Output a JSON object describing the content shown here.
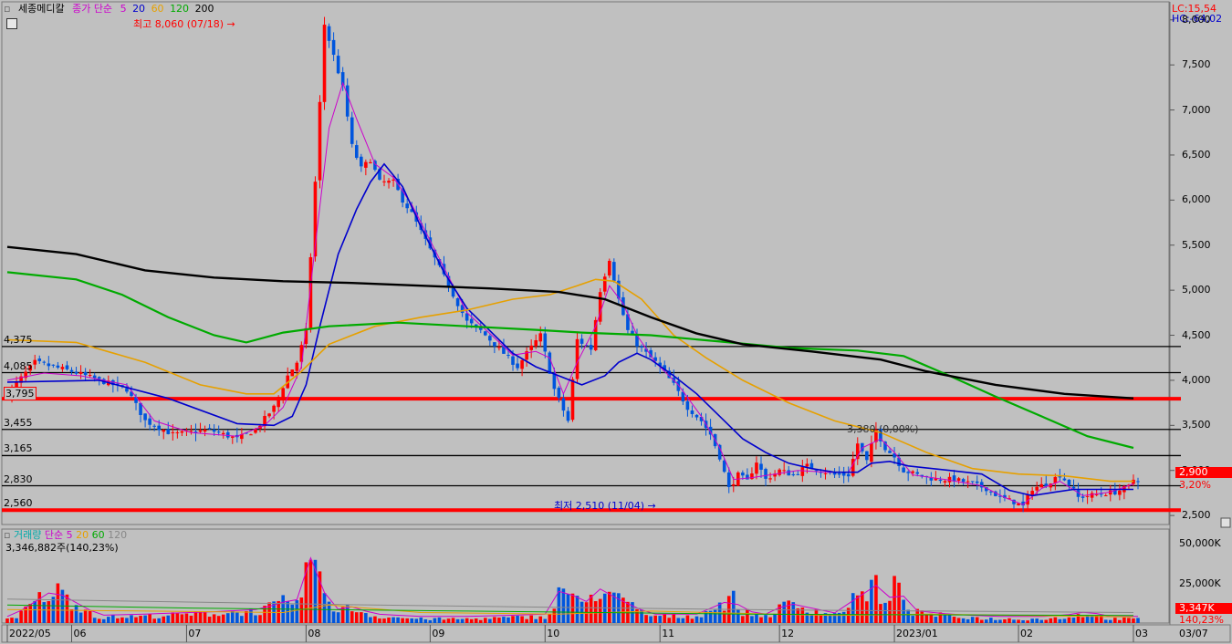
{
  "header": {
    "stock_name": "세종메디칼",
    "ma_title": "종가 단순",
    "ma_periods": [
      "5",
      "20",
      "60",
      "120",
      "200"
    ],
    "ma_colors": [
      "#cc00cc",
      "#0000cc",
      "#e6a000",
      "#00aa00",
      "#000000"
    ]
  },
  "top_right": {
    "lc": "LC:15,54",
    "hc": "HC:-64,02"
  },
  "annotations": {
    "high": "최고 8,060 (07/18)",
    "low": "최저 2,510 (11/04)",
    "mid": "3,380 (0,00%)"
  },
  "price_axis": [
    "8,000",
    "7,500",
    "7,000",
    "6,500",
    "6,000",
    "5,500",
    "5,000",
    "4,500",
    "4,000",
    "3,500",
    "3,000",
    "2,500"
  ],
  "current": {
    "price": "2,900",
    "change": "3,20%"
  },
  "levels": [
    {
      "label": "4,375",
      "value": 4375,
      "color": "#000000",
      "bold": false
    },
    {
      "label": "4,085",
      "value": 4085,
      "color": "#000000",
      "bold": false
    },
    {
      "label": "3,795",
      "value": 3795,
      "color": "#ff0000",
      "bold": true
    },
    {
      "label": "3,455",
      "value": 3455,
      "color": "#000000",
      "bold": false
    },
    {
      "label": "3,165",
      "value": 3165,
      "color": "#000000",
      "bold": false
    },
    {
      "label": "2,830",
      "value": 2830,
      "color": "#000000",
      "bold": false
    },
    {
      "label": "2,560",
      "value": 2560,
      "color": "#ff0000",
      "bold": true
    }
  ],
  "volume": {
    "title": "거래량",
    "ma_title": "단순",
    "ma_periods": [
      "5",
      "20",
      "60",
      "120"
    ],
    "info": "3,346,882주(140,23%)",
    "axis": [
      "50,000K",
      "25,000K"
    ],
    "current": "3,347K",
    "pct": "140,23%"
  },
  "date_axis": [
    "2022/05",
    "06",
    "07",
    "08",
    "09",
    "10",
    "11",
    "12",
    "2023/01",
    "02",
    "03",
    "03/07"
  ],
  "chart_data": {
    "type": "candlestick",
    "title": "세종메디칼",
    "ylim": [
      2400,
      8200
    ],
    "xlabels": [
      "2022/05",
      "06",
      "07",
      "08",
      "09",
      "10",
      "11",
      "12",
      "2023/01",
      "02",
      "03"
    ],
    "high": {
      "value": 8060,
      "date": "07/18"
    },
    "low": {
      "value": 2510,
      "date": "11/04"
    },
    "close_series": [
      [
        0,
        3850
      ],
      [
        6,
        4200
      ],
      [
        14,
        4100
      ],
      [
        26,
        3900
      ],
      [
        30,
        3550
      ],
      [
        36,
        3400
      ],
      [
        44,
        3450
      ],
      [
        50,
        3350
      ],
      [
        54,
        3450
      ],
      [
        58,
        3700
      ],
      [
        61,
        4050
      ],
      [
        63,
        4200
      ],
      [
        65,
        4550
      ],
      [
        67,
        6200
      ],
      [
        69,
        7950
      ],
      [
        71,
        7600
      ],
      [
        73,
        7250
      ],
      [
        75,
        6600
      ],
      [
        77,
        6350
      ],
      [
        79,
        6450
      ],
      [
        81,
        6200
      ],
      [
        84,
        6200
      ],
      [
        86,
        6000
      ],
      [
        88,
        5850
      ],
      [
        91,
        5550
      ],
      [
        95,
        5150
      ],
      [
        98,
        4850
      ],
      [
        100,
        4650
      ],
      [
        103,
        4550
      ],
      [
        106,
        4400
      ],
      [
        109,
        4250
      ],
      [
        111,
        4150
      ],
      [
        113,
        4300
      ],
      [
        116,
        4500
      ],
      [
        119,
        3900
      ],
      [
        122,
        3550
      ],
      [
        124,
        4450
      ],
      [
        127,
        4350
      ],
      [
        129,
        5000
      ],
      [
        131,
        5350
      ],
      [
        133,
        4900
      ],
      [
        135,
        4550
      ],
      [
        137,
        4400
      ],
      [
        139,
        4300
      ],
      [
        142,
        4150
      ],
      [
        145,
        3950
      ],
      [
        148,
        3700
      ],
      [
        151,
        3550
      ],
      [
        153,
        3400
      ],
      [
        155,
        3150
      ],
      [
        157,
        2800
      ],
      [
        159,
        2950
      ],
      [
        161,
        2880
      ],
      [
        163,
        3100
      ],
      [
        165,
        2900
      ],
      [
        168,
        3000
      ],
      [
        171,
        2950
      ],
      [
        174,
        3050
      ],
      [
        177,
        3000
      ],
      [
        180,
        2950
      ],
      [
        183,
        2950
      ],
      [
        185,
        3300
      ],
      [
        187,
        3100
      ],
      [
        189,
        3450
      ],
      [
        191,
        3250
      ],
      [
        193,
        3150
      ],
      [
        195,
        3000
      ],
      [
        198,
        2950
      ],
      [
        202,
        2900
      ],
      [
        206,
        2900
      ],
      [
        210,
        2850
      ],
      [
        213,
        2800
      ],
      [
        216,
        2700
      ],
      [
        219,
        2650
      ],
      [
        221,
        2600
      ],
      [
        223,
        2800
      ],
      [
        226,
        2850
      ],
      [
        229,
        2950
      ],
      [
        231,
        2850
      ],
      [
        233,
        2700
      ],
      [
        235,
        2720
      ],
      [
        238,
        2740
      ],
      [
        241,
        2760
      ],
      [
        244,
        2820
      ],
      [
        245,
        2900
      ]
    ],
    "ma_series": [
      {
        "name": "20",
        "color": "#0000cc",
        "values": [
          [
            0,
            3980
          ],
          [
            20,
            4000
          ],
          [
            35,
            3800
          ],
          [
            50,
            3520
          ],
          [
            58,
            3500
          ],
          [
            62,
            3600
          ],
          [
            65,
            3950
          ],
          [
            68,
            4600
          ],
          [
            72,
            5400
          ],
          [
            76,
            5900
          ],
          [
            79,
            6200
          ],
          [
            82,
            6400
          ],
          [
            86,
            6150
          ],
          [
            90,
            5700
          ],
          [
            95,
            5200
          ],
          [
            100,
            4800
          ],
          [
            105,
            4550
          ],
          [
            110,
            4300
          ],
          [
            115,
            4150
          ],
          [
            120,
            4050
          ],
          [
            125,
            3950
          ],
          [
            130,
            4050
          ],
          [
            133,
            4200
          ],
          [
            137,
            4300
          ],
          [
            140,
            4230
          ],
          [
            145,
            4050
          ],
          [
            150,
            3850
          ],
          [
            155,
            3600
          ],
          [
            160,
            3350
          ],
          [
            165,
            3200
          ],
          [
            170,
            3080
          ],
          [
            175,
            3020
          ],
          [
            180,
            2980
          ],
          [
            185,
            2980
          ],
          [
            188,
            3080
          ],
          [
            192,
            3100
          ],
          [
            196,
            3050
          ],
          [
            205,
            3000
          ],
          [
            212,
            2960
          ],
          [
            218,
            2780
          ],
          [
            223,
            2720
          ],
          [
            228,
            2760
          ],
          [
            232,
            2790
          ],
          [
            238,
            2790
          ],
          [
            245,
            2790
          ]
        ]
      },
      {
        "name": "60",
        "color": "#e6a000",
        "values": [
          [
            0,
            4450
          ],
          [
            15,
            4420
          ],
          [
            30,
            4200
          ],
          [
            42,
            3950
          ],
          [
            52,
            3850
          ],
          [
            58,
            3850
          ],
          [
            64,
            4100
          ],
          [
            70,
            4400
          ],
          [
            80,
            4600
          ],
          [
            90,
            4700
          ],
          [
            100,
            4780
          ],
          [
            110,
            4900
          ],
          [
            118,
            4950
          ],
          [
            124,
            5050
          ],
          [
            128,
            5120
          ],
          [
            132,
            5100
          ],
          [
            138,
            4900
          ],
          [
            145,
            4500
          ],
          [
            152,
            4250
          ],
          [
            160,
            4000
          ],
          [
            170,
            3750
          ],
          [
            180,
            3550
          ],
          [
            190,
            3420
          ],
          [
            200,
            3200
          ],
          [
            210,
            3020
          ],
          [
            220,
            2960
          ],
          [
            230,
            2940
          ],
          [
            240,
            2880
          ],
          [
            245,
            2880
          ]
        ]
      },
      {
        "name": "120",
        "color": "#00aa00",
        "values": [
          [
            0,
            5200
          ],
          [
            15,
            5120
          ],
          [
            25,
            4950
          ],
          [
            35,
            4700
          ],
          [
            45,
            4500
          ],
          [
            52,
            4420
          ],
          [
            60,
            4530
          ],
          [
            70,
            4600
          ],
          [
            85,
            4640
          ],
          [
            100,
            4600
          ],
          [
            115,
            4560
          ],
          [
            125,
            4530
          ],
          [
            140,
            4500
          ],
          [
            155,
            4430
          ],
          [
            170,
            4360
          ],
          [
            185,
            4330
          ],
          [
            195,
            4270
          ],
          [
            205,
            4050
          ],
          [
            215,
            3820
          ],
          [
            225,
            3600
          ],
          [
            235,
            3380
          ],
          [
            245,
            3250
          ]
        ]
      },
      {
        "name": "200",
        "color": "#000000",
        "values": [
          [
            0,
            5480
          ],
          [
            15,
            5400
          ],
          [
            30,
            5220
          ],
          [
            45,
            5140
          ],
          [
            60,
            5100
          ],
          [
            75,
            5080
          ],
          [
            90,
            5050
          ],
          [
            105,
            5020
          ],
          [
            120,
            4980
          ],
          [
            130,
            4900
          ],
          [
            140,
            4700
          ],
          [
            150,
            4520
          ],
          [
            160,
            4400
          ],
          [
            175,
            4320
          ],
          [
            190,
            4230
          ],
          [
            200,
            4100
          ],
          [
            215,
            3950
          ],
          [
            230,
            3850
          ],
          [
            245,
            3800
          ]
        ]
      }
    ],
    "ma5_values": [
      [
        0,
        4000
      ],
      [
        8,
        4080
      ],
      [
        16,
        4050
      ],
      [
        26,
        3950
      ],
      [
        32,
        3550
      ],
      [
        40,
        3420
      ],
      [
        50,
        3380
      ],
      [
        56,
        3500
      ],
      [
        60,
        3700
      ],
      [
        64,
        4150
      ],
      [
        67,
        5500
      ],
      [
        70,
        6800
      ],
      [
        73,
        7300
      ],
      [
        76,
        6900
      ],
      [
        80,
        6400
      ],
      [
        84,
        6250
      ],
      [
        88,
        5950
      ],
      [
        92,
        5550
      ],
      [
        96,
        5150
      ],
      [
        100,
        4750
      ],
      [
        105,
        4520
      ],
      [
        110,
        4280
      ],
      [
        115,
        4320
      ],
      [
        118,
        4250
      ],
      [
        121,
        3850
      ],
      [
        124,
        4200
      ],
      [
        128,
        4600
      ],
      [
        131,
        5050
      ],
      [
        134,
        4850
      ],
      [
        137,
        4500
      ],
      [
        141,
        4200
      ],
      [
        146,
        3950
      ],
      [
        151,
        3600
      ],
      [
        155,
        3250
      ],
      [
        158,
        2900
      ],
      [
        162,
        2920
      ],
      [
        167,
        2960
      ],
      [
        172,
        3000
      ],
      [
        178,
        2980
      ],
      [
        183,
        2980
      ],
      [
        186,
        3250
      ],
      [
        190,
        3350
      ],
      [
        193,
        3200
      ],
      [
        197,
        2950
      ],
      [
        204,
        2900
      ],
      [
        212,
        2830
      ],
      [
        217,
        2700
      ],
      [
        221,
        2620
      ],
      [
        225,
        2800
      ],
      [
        229,
        2880
      ],
      [
        234,
        2720
      ],
      [
        240,
        2760
      ],
      [
        245,
        2850
      ]
    ],
    "volume_values": [
      [
        3,
        8
      ],
      [
        10,
        25
      ],
      [
        20,
        4
      ],
      [
        30,
        5
      ],
      [
        45,
        7
      ],
      [
        55,
        9
      ],
      [
        60,
        15
      ],
      [
        62,
        10
      ],
      [
        64,
        24
      ],
      [
        66,
        52
      ],
      [
        67,
        38
      ],
      [
        68,
        28
      ],
      [
        70,
        18
      ],
      [
        72,
        9
      ],
      [
        75,
        11
      ],
      [
        80,
        5
      ],
      [
        90,
        3
      ],
      [
        100,
        3
      ],
      [
        110,
        4
      ],
      [
        118,
        5
      ],
      [
        120,
        24
      ],
      [
        122,
        25
      ],
      [
        125,
        12
      ],
      [
        129,
        26
      ],
      [
        131,
        22
      ],
      [
        133,
        17
      ],
      [
        136,
        12
      ],
      [
        140,
        5
      ],
      [
        150,
        5
      ],
      [
        158,
        18
      ],
      [
        160,
        8
      ],
      [
        165,
        5
      ],
      [
        170,
        14
      ],
      [
        180,
        6
      ],
      [
        189,
        29
      ],
      [
        191,
        12
      ],
      [
        193,
        26
      ],
      [
        195,
        20
      ],
      [
        197,
        8
      ],
      [
        205,
        5
      ],
      [
        215,
        3
      ],
      [
        225,
        3
      ],
      [
        230,
        4
      ],
      [
        235,
        7
      ],
      [
        240,
        3
      ],
      [
        245,
        3
      ]
    ],
    "volume_ylim": [
      0,
      58
    ]
  }
}
